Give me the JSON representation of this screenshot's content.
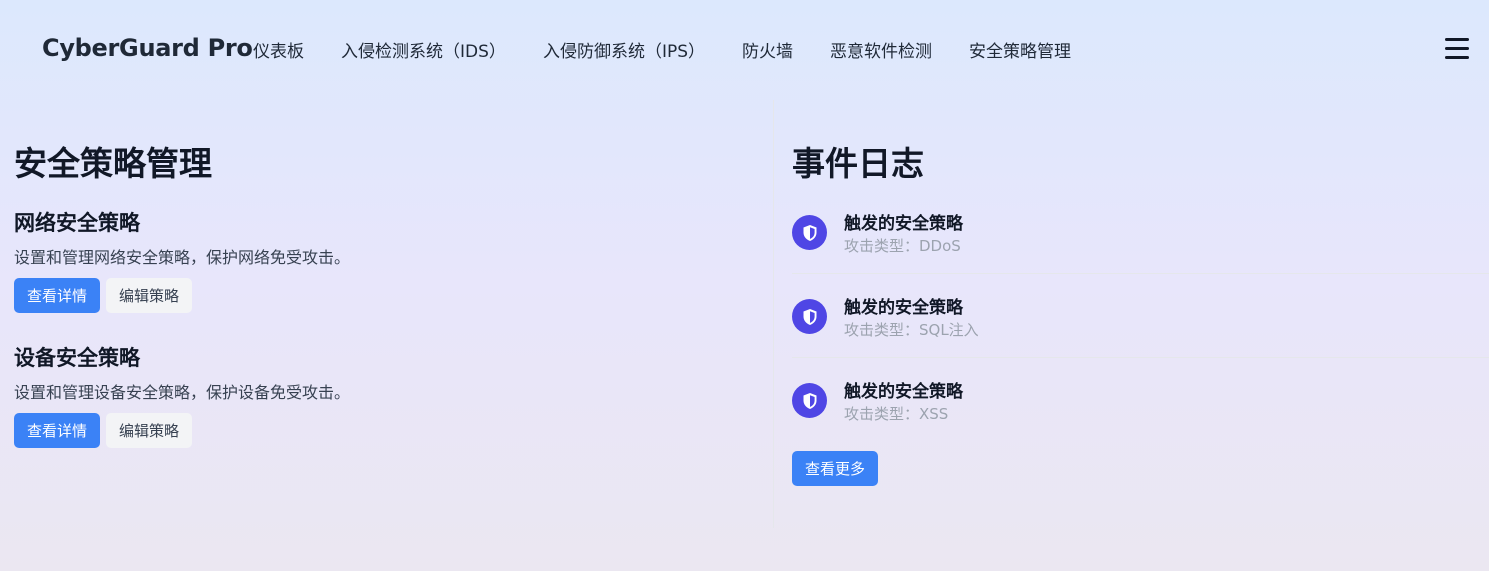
{
  "brand": "CyberGuard Pro",
  "nav": [
    {
      "label": "仪表板"
    },
    {
      "label": "入侵检测系统（IDS）"
    },
    {
      "label": "入侵防御系统（IPS）"
    },
    {
      "label": "防火墙"
    },
    {
      "label": "恶意软件检测"
    },
    {
      "label": "安全策略管理"
    }
  ],
  "left": {
    "title": "安全策略管理",
    "policies": [
      {
        "title": "网络安全策略",
        "description": "设置和管理网络安全策略，保护网络免受攻击。",
        "view_label": "查看详情",
        "edit_label": "编辑策略"
      },
      {
        "title": "设备安全策略",
        "description": "设置和管理设备安全策略，保护设备免受攻击。",
        "view_label": "查看详情",
        "edit_label": "编辑策略"
      }
    ]
  },
  "right": {
    "title": "事件日志",
    "events": [
      {
        "title": "触发的安全策略",
        "subtitle": "攻击类型：DDoS",
        "icon": "shield-icon"
      },
      {
        "title": "触发的安全策略",
        "subtitle": "攻击类型：SQL注入",
        "icon": "shield-icon"
      },
      {
        "title": "触发的安全策略",
        "subtitle": "攻击类型：XSS",
        "icon": "shield-icon"
      }
    ],
    "more_label": "查看更多"
  },
  "colors": {
    "primary": "#3b82f6",
    "icon_bg": "#4f46e5"
  }
}
